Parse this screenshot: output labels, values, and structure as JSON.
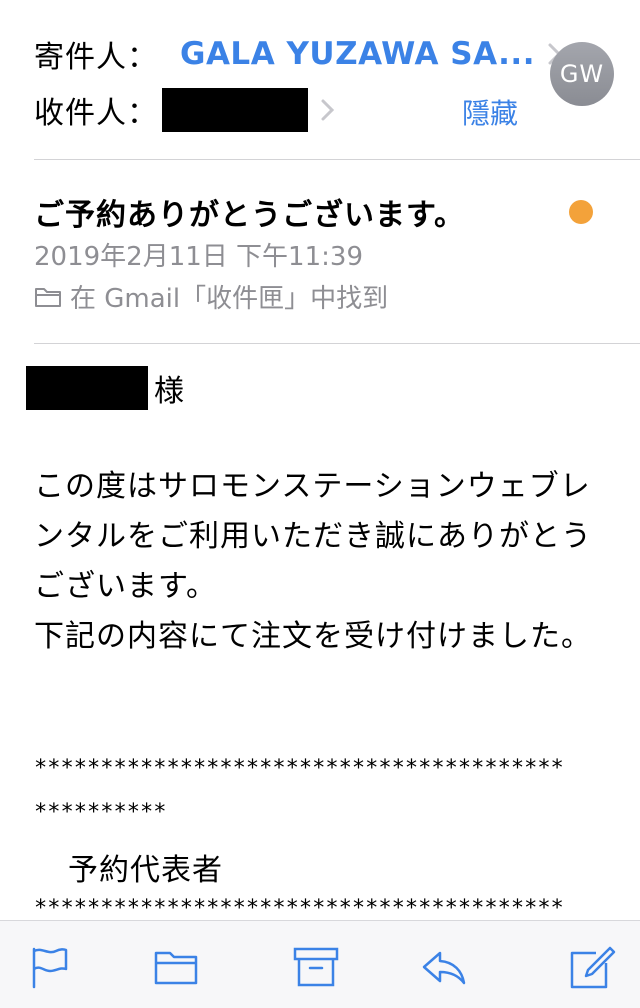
{
  "header": {
    "from_label": "寄件人：",
    "sender_name": "GALA YUZAWA SA...",
    "to_label": "收件人：",
    "hide_label": "隱藏",
    "avatar_initials": "GW"
  },
  "message": {
    "subject": "ご予約ありがとうございます。",
    "date": "2019年2月11日 下午11:39",
    "folder": "在 Gmail「收件匣」中找到",
    "salutation_suffix": "様",
    "paragraph1": "この度はサロモンステーションウェブレンタルをご利用いただき誠にありがとうございます。",
    "paragraph2": "下記の内容にて注文を受け付けました。",
    "stars_line1": "****************************************",
    "stars_line2": "**********",
    "section_title": "予約代表者",
    "stars_line3": "****************************************"
  },
  "colors": {
    "link": "#3b82e6",
    "unread": "#f3a23a",
    "muted": "#8e8e93"
  },
  "toolbar": {
    "icons": [
      "flag-icon",
      "folder-icon",
      "archive-icon",
      "reply-icon",
      "compose-icon"
    ]
  }
}
